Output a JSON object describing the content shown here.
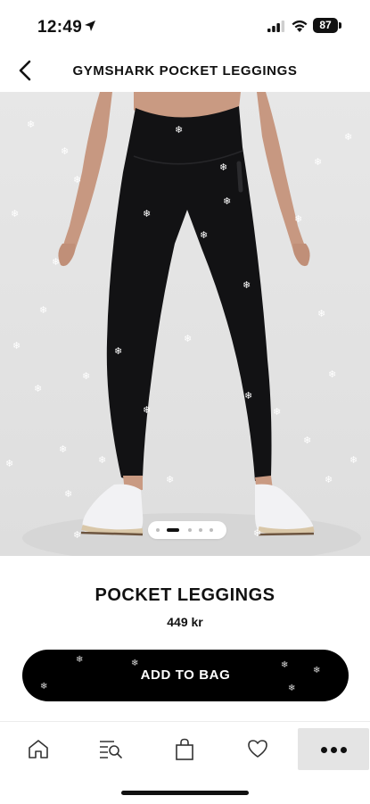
{
  "status": {
    "time": "12:49",
    "battery": "87"
  },
  "nav": {
    "title": "GYMSHARK POCKET LEGGINGS"
  },
  "product": {
    "name": "POCKET LEGGINGS",
    "price": "449 kr",
    "add_to_bag": "ADD TO BAG",
    "image_index": 2,
    "image_count": 5
  },
  "tabs": [
    {
      "icon": "home-icon"
    },
    {
      "icon": "search-list-icon"
    },
    {
      "icon": "bag-icon"
    },
    {
      "icon": "heart-icon"
    },
    {
      "icon": "more-icon"
    }
  ],
  "colors": {
    "accent": "#000000",
    "background": "#ffffff",
    "legging": "#121214",
    "sneaker": "#f2f2f4"
  }
}
